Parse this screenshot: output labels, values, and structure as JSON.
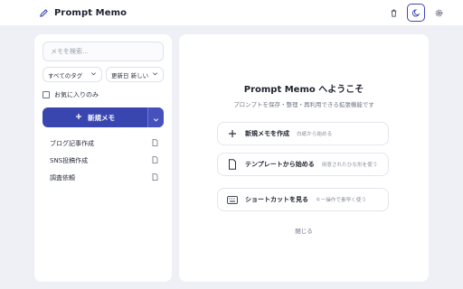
{
  "header": {
    "title": "Prompt Memo",
    "icons": [
      "pencil-icon",
      "trash-icon",
      "moon-icon",
      "gear-icon"
    ],
    "accent": "#3b49b8"
  },
  "sidebar": {
    "search_placeholder": "メモを検索...",
    "tag_filter": "すべてのタグ",
    "sort": "更新日 新しい",
    "favorites_label": "お気に入りのみ",
    "new_memo_label": "新規メモ",
    "memos": [
      {
        "title": "ブログ記事作成"
      },
      {
        "title": "SNS投稿作成"
      },
      {
        "title": "調査依頼"
      }
    ]
  },
  "welcome": {
    "title": "Prompt Memo へようこそ",
    "subtitle": "プロンプトを保存・整理・再利用できる拡張機能です",
    "options": [
      {
        "label": "新規メモを作成",
        "desc": "白紙から始める"
      },
      {
        "label": "テンプレートから始める",
        "desc": "用意されたひな形を使う"
      },
      {
        "label": "ショートカットを見る",
        "desc": "キー操作で素早く使う"
      }
    ],
    "close_label": "閉じる"
  },
  "colors": {
    "primary_button": "#3a46b0",
    "background": "#eef0f6"
  }
}
